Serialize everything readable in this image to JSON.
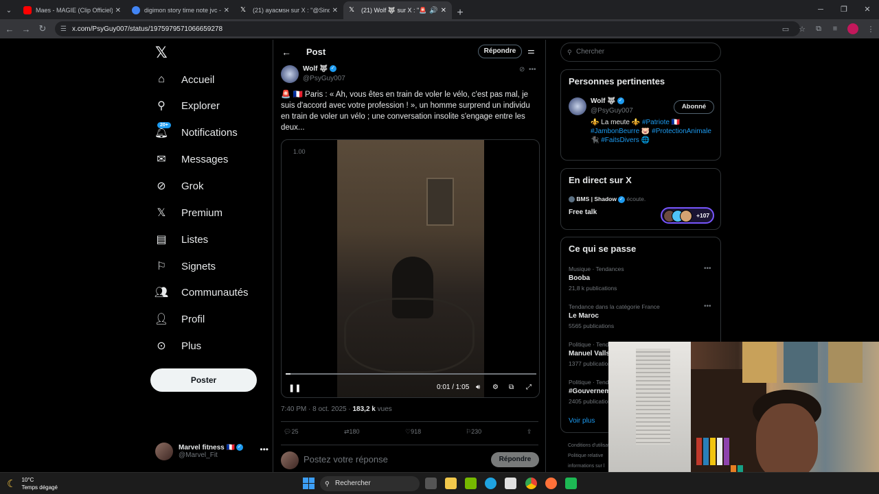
{
  "browser": {
    "tabs": [
      {
        "title": "Maes - MAGIE (Clip Officiel) - Y",
        "color": "#ff0000"
      },
      {
        "title": "digimon story time note jvc - Re",
        "color": "#ffffff"
      },
      {
        "title": "(21) аyacмsн sur X : \"@SindyOl",
        "color": "#000000"
      },
      {
        "title": "(21) Wolf 🐺 sur X : \"🚨 🇫🇷 Pa",
        "color": "#000000"
      }
    ],
    "url": "x.com/PsyGuy007/status/1975979571066659278"
  },
  "nav": {
    "items": [
      {
        "label": "Accueil"
      },
      {
        "label": "Explorer"
      },
      {
        "label": "Notifications",
        "badge": "20+"
      },
      {
        "label": "Messages"
      },
      {
        "label": "Grok"
      },
      {
        "label": "Premium"
      },
      {
        "label": "Listes"
      },
      {
        "label": "Signets"
      },
      {
        "label": "Communautés"
      },
      {
        "label": "Profil"
      },
      {
        "label": "Plus"
      }
    ],
    "post_button": "Poster",
    "account": {
      "name": "Marvel fitness 🇫🇷",
      "handle": "@Marvel_Fit"
    }
  },
  "post": {
    "header_title": "Post",
    "reply_button": "Répondre",
    "author_name": "Wolf 🐺",
    "author_handle": "@PsyGuy007",
    "text": "🚨 🇫🇷 Paris : « Ah, vous êtes en train de voler le vélo, c'est pas mal, je suis d'accord avec votre profession ! », un homme surprend un individu en train de voler un vélo ; une conversation insolite s'engage entre les deux...",
    "video": {
      "speed": "1.00",
      "time": "0:01 / 1:05",
      "progress": 0.02
    },
    "timestamp": "7:40 PM · 8 oct. 2025 · ",
    "views_count": "183,2 k",
    "views_label": " vues",
    "stats": {
      "replies": "25",
      "reposts": "180",
      "likes": "918",
      "bookmarks": "230"
    },
    "compose_placeholder": "Postez votre réponse",
    "compose_button": "Répondre"
  },
  "sidebar": {
    "search_placeholder": "Chercher",
    "relevant": {
      "title": "Personnes pertinentes",
      "name": "Wolf 🐺",
      "handle": "@PsyGuy007",
      "follow_button": "Abonné",
      "bio_prefix": "⚜️ La meute ⚜️ ",
      "bio_tag1": "#Patriote",
      "bio_mid": " 🇫🇷 ",
      "bio_tag2": "#JambonBeurre",
      "bio_after2": " 🐷 ",
      "bio_tag3": "#ProtectionAnimale",
      "bio_after3": " 🐈‍⬛ ",
      "bio_tag4": "#FaitsDivers",
      "bio_end": " 🌐"
    },
    "live": {
      "title": "En direct sur X",
      "host": "BMS | Shadow",
      "status": " écoute.",
      "space_title": "Free talk",
      "listeners": "+107"
    },
    "trends": {
      "title": "Ce qui se passe",
      "items": [
        {
          "category": "Musique · Tendances",
          "name": "Booba",
          "count": "21,8 k publications"
        },
        {
          "category": "Tendance dans la catégorie France",
          "name": "Le Maroc",
          "count": "5565 publications"
        },
        {
          "category": "Politique · Tendances",
          "name": "Manuel Valls",
          "count": "1377 publications"
        },
        {
          "category": "Politique · Tendances",
          "name": "#Gouvernement",
          "count": "2405 publications"
        }
      ],
      "see_more": "Voir plus"
    },
    "legal": [
      "Conditions d'utilisation",
      "Politique relative",
      "informations sur l"
    ]
  },
  "taskbar": {
    "temp": "10°C",
    "weather": "Temps dégagé",
    "search": "Rechercher"
  }
}
